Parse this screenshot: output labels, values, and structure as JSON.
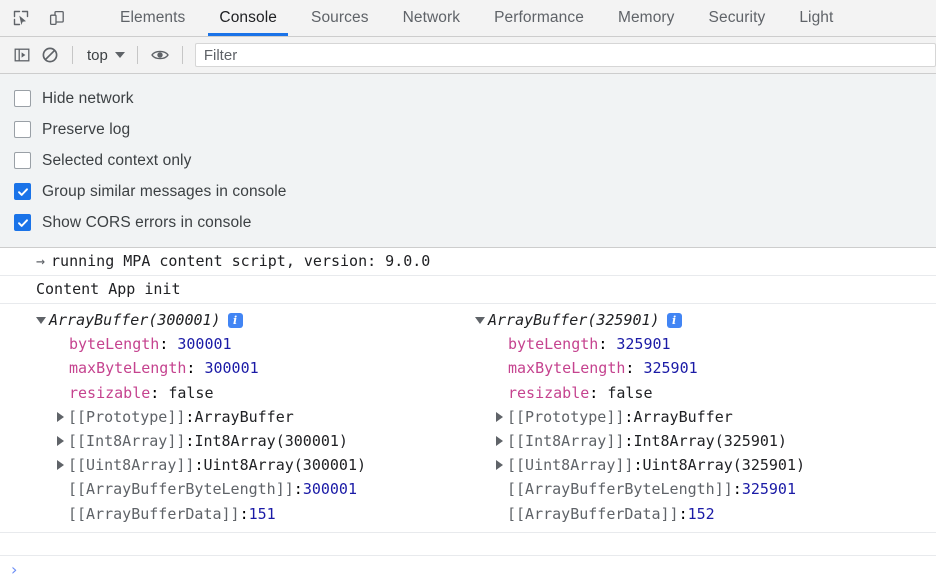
{
  "window": {
    "title": "DevTools Console"
  },
  "tabbar": {
    "inspect_icon": "inspect-cursor-icon",
    "device_icon": "device-toolbar-icon",
    "tabs": [
      {
        "label": "Elements",
        "active": false
      },
      {
        "label": "Console",
        "active": true
      },
      {
        "label": "Sources",
        "active": false
      },
      {
        "label": "Network",
        "active": false
      },
      {
        "label": "Performance",
        "active": false
      },
      {
        "label": "Memory",
        "active": false
      },
      {
        "label": "Security",
        "active": false
      },
      {
        "label": "Light",
        "active": false
      }
    ]
  },
  "console_toolbar": {
    "sidebar_toggle_icon": "console-sidebar-toggle-icon",
    "clear_icon": "clear-console-icon",
    "context_value": "top",
    "eye_icon": "live-expression-eye-icon",
    "filter_placeholder": "Filter",
    "filter_value": ""
  },
  "settings": {
    "options": [
      {
        "label": "Hide network",
        "checked": false
      },
      {
        "label": "Preserve log",
        "checked": false
      },
      {
        "label": "Selected context only",
        "checked": false
      },
      {
        "label": "Group similar messages in console",
        "checked": true
      },
      {
        "label": "Show CORS errors in console",
        "checked": true
      }
    ]
  },
  "console_output": {
    "messages": [
      {
        "arrow": "→",
        "text": "running MPA content script, version: 9.0.0"
      },
      {
        "arrow": "",
        "text": "Content App init"
      }
    ],
    "objects": [
      {
        "header": "ArrayBuffer(300001)",
        "info_icon": "info-icon",
        "properties": [
          {
            "name": "byteLength",
            "value": "300001",
            "type": "number"
          },
          {
            "name": "maxByteLength",
            "value": "300001",
            "type": "number"
          },
          {
            "name": "resizable",
            "value": "false",
            "type": "boolean"
          }
        ],
        "slots": [
          {
            "name": "[[Prototype]]",
            "value": "ArrayBuffer",
            "type": "string",
            "expandable": true
          },
          {
            "name": "[[Int8Array]]",
            "value": "Int8Array(300001)",
            "type": "string",
            "expandable": true
          },
          {
            "name": "[[Uint8Array]]",
            "value": "Uint8Array(300001)",
            "type": "string",
            "expandable": true
          },
          {
            "name": "[[ArrayBufferByteLength]]",
            "value": "300001",
            "type": "number",
            "expandable": false
          },
          {
            "name": "[[ArrayBufferData]]",
            "value": "151",
            "type": "number",
            "expandable": false
          }
        ]
      },
      {
        "header": "ArrayBuffer(325901)",
        "info_icon": "info-icon",
        "properties": [
          {
            "name": "byteLength",
            "value": "325901",
            "type": "number"
          },
          {
            "name": "maxByteLength",
            "value": "325901",
            "type": "number"
          },
          {
            "name": "resizable",
            "value": "false",
            "type": "boolean"
          }
        ],
        "slots": [
          {
            "name": "[[Prototype]]",
            "value": "ArrayBuffer",
            "type": "string",
            "expandable": true
          },
          {
            "name": "[[Int8Array]]",
            "value": "Int8Array(325901)",
            "type": "string",
            "expandable": true
          },
          {
            "name": "[[Uint8Array]]",
            "value": "Uint8Array(325901)",
            "type": "string",
            "expandable": true
          },
          {
            "name": "[[ArrayBufferByteLength]]",
            "value": "325901",
            "type": "number",
            "expandable": false
          },
          {
            "name": "[[ArrayBufferData]]",
            "value": "152",
            "type": "number",
            "expandable": false
          }
        ]
      }
    ]
  },
  "prompt": {
    "chevron": "›"
  },
  "colors": {
    "accent": "#1a73e8",
    "property_name": "#c5438f",
    "number_value": "#1a1aa6",
    "slot_name": "#5f6368",
    "info_icon_bg": "#4285f4",
    "toolbar_bg": "#f3f3f3",
    "settings_bg": "#f1f3f4"
  }
}
